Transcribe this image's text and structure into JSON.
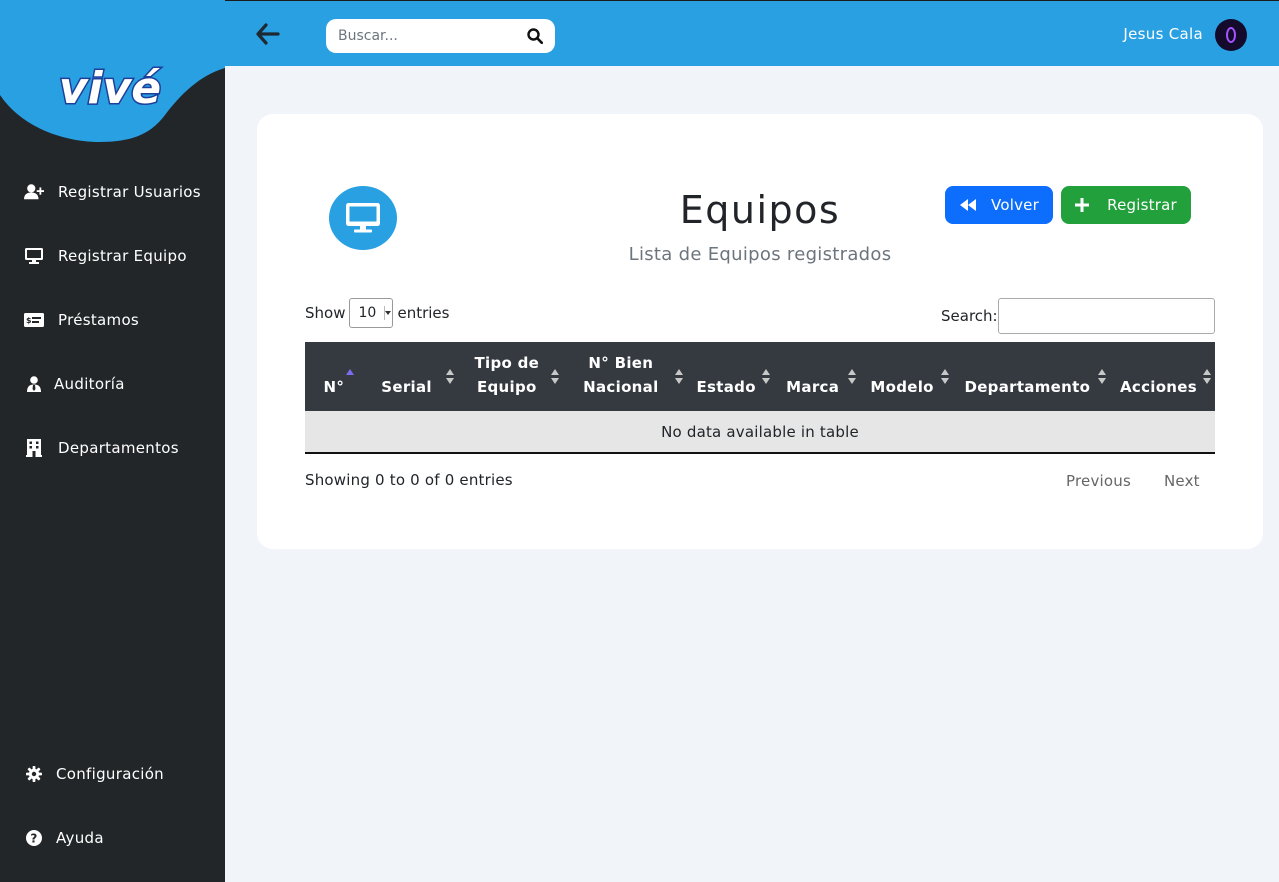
{
  "brand": {
    "logo_text": "vivé"
  },
  "sidebar": {
    "items": [
      {
        "label": "Registrar Usuarios",
        "icon": "user-plus-icon"
      },
      {
        "label": "Registrar Equipo",
        "icon": "desktop-icon"
      },
      {
        "label": "Préstamos",
        "icon": "money-check-icon"
      },
      {
        "label": "Auditoría",
        "icon": "user-tie-icon"
      },
      {
        "label": "Departamentos",
        "icon": "building-icon"
      }
    ],
    "bottom_items": [
      {
        "label": "Configuración",
        "icon": "gear-icon"
      },
      {
        "label": "Ayuda",
        "icon": "question-circle-icon"
      }
    ]
  },
  "topbar": {
    "search_placeholder": "Buscar...",
    "user_name": "Jesus Cala"
  },
  "page": {
    "title": "Equipos",
    "subtitle": "Lista de Equipos registrados",
    "buttons": {
      "back": "Volver",
      "register": "Registrar"
    }
  },
  "table": {
    "show_label": "Show",
    "entries_label": "entries",
    "page_length": "10",
    "search_label": "Search:",
    "columns": [
      [
        "N°"
      ],
      [
        "Serial"
      ],
      [
        "Tipo de",
        "Equipo"
      ],
      [
        "N° Bien",
        "Nacional"
      ],
      [
        "Estado"
      ],
      [
        "Marca"
      ],
      [
        "Modelo"
      ],
      [
        "Departamento"
      ],
      [
        "Acciones"
      ]
    ],
    "sorted_column": "N°",
    "empty_message": "No data available in table",
    "info": "Showing 0 to 0 of 0 entries",
    "previous": "Previous",
    "next": "Next"
  },
  "colors": {
    "sidebar_bg": "#222629",
    "topbar_bg": "#29a0e2",
    "page_bg": "#f1f4f9",
    "table_header_bg": "#343a40",
    "volver_button": "#0d6efd",
    "registrar_button": "#22a03c"
  }
}
